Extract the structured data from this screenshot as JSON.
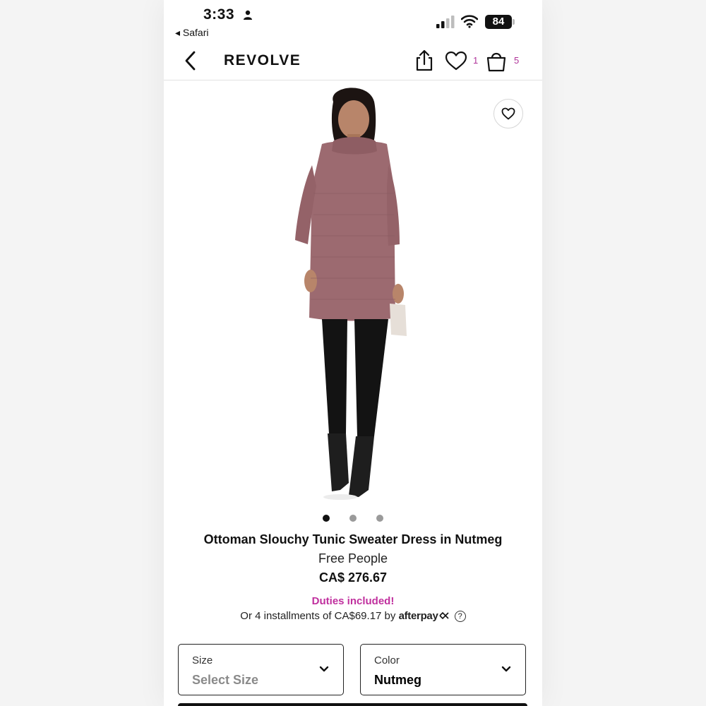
{
  "status_bar": {
    "time": "3:33",
    "back_app": "◂ Safari",
    "battery": "84"
  },
  "header": {
    "logo": "REVOLVE",
    "wishlist_count": "1",
    "bag_count": "5"
  },
  "gallery": {
    "image_description": "model wearing mauve knit tunic sweater dress with black leggings and ankle boots",
    "total_images": 3,
    "active_index": 0
  },
  "product": {
    "title": "Ottoman Slouchy Tunic Sweater Dress in Nutmeg",
    "brand": "Free People",
    "price": "CA$ 276.67",
    "duties": "Duties included!",
    "installments_prefix": "Or 4 installments of CA$69.17 by",
    "afterpay": "afterpay",
    "help": "?"
  },
  "size": {
    "label": "Size",
    "value": "Select Size"
  },
  "color": {
    "label": "Color",
    "value": "Nutmeg"
  },
  "colors": {
    "accent": "#c0309e",
    "sweater": "#9c6a70"
  }
}
